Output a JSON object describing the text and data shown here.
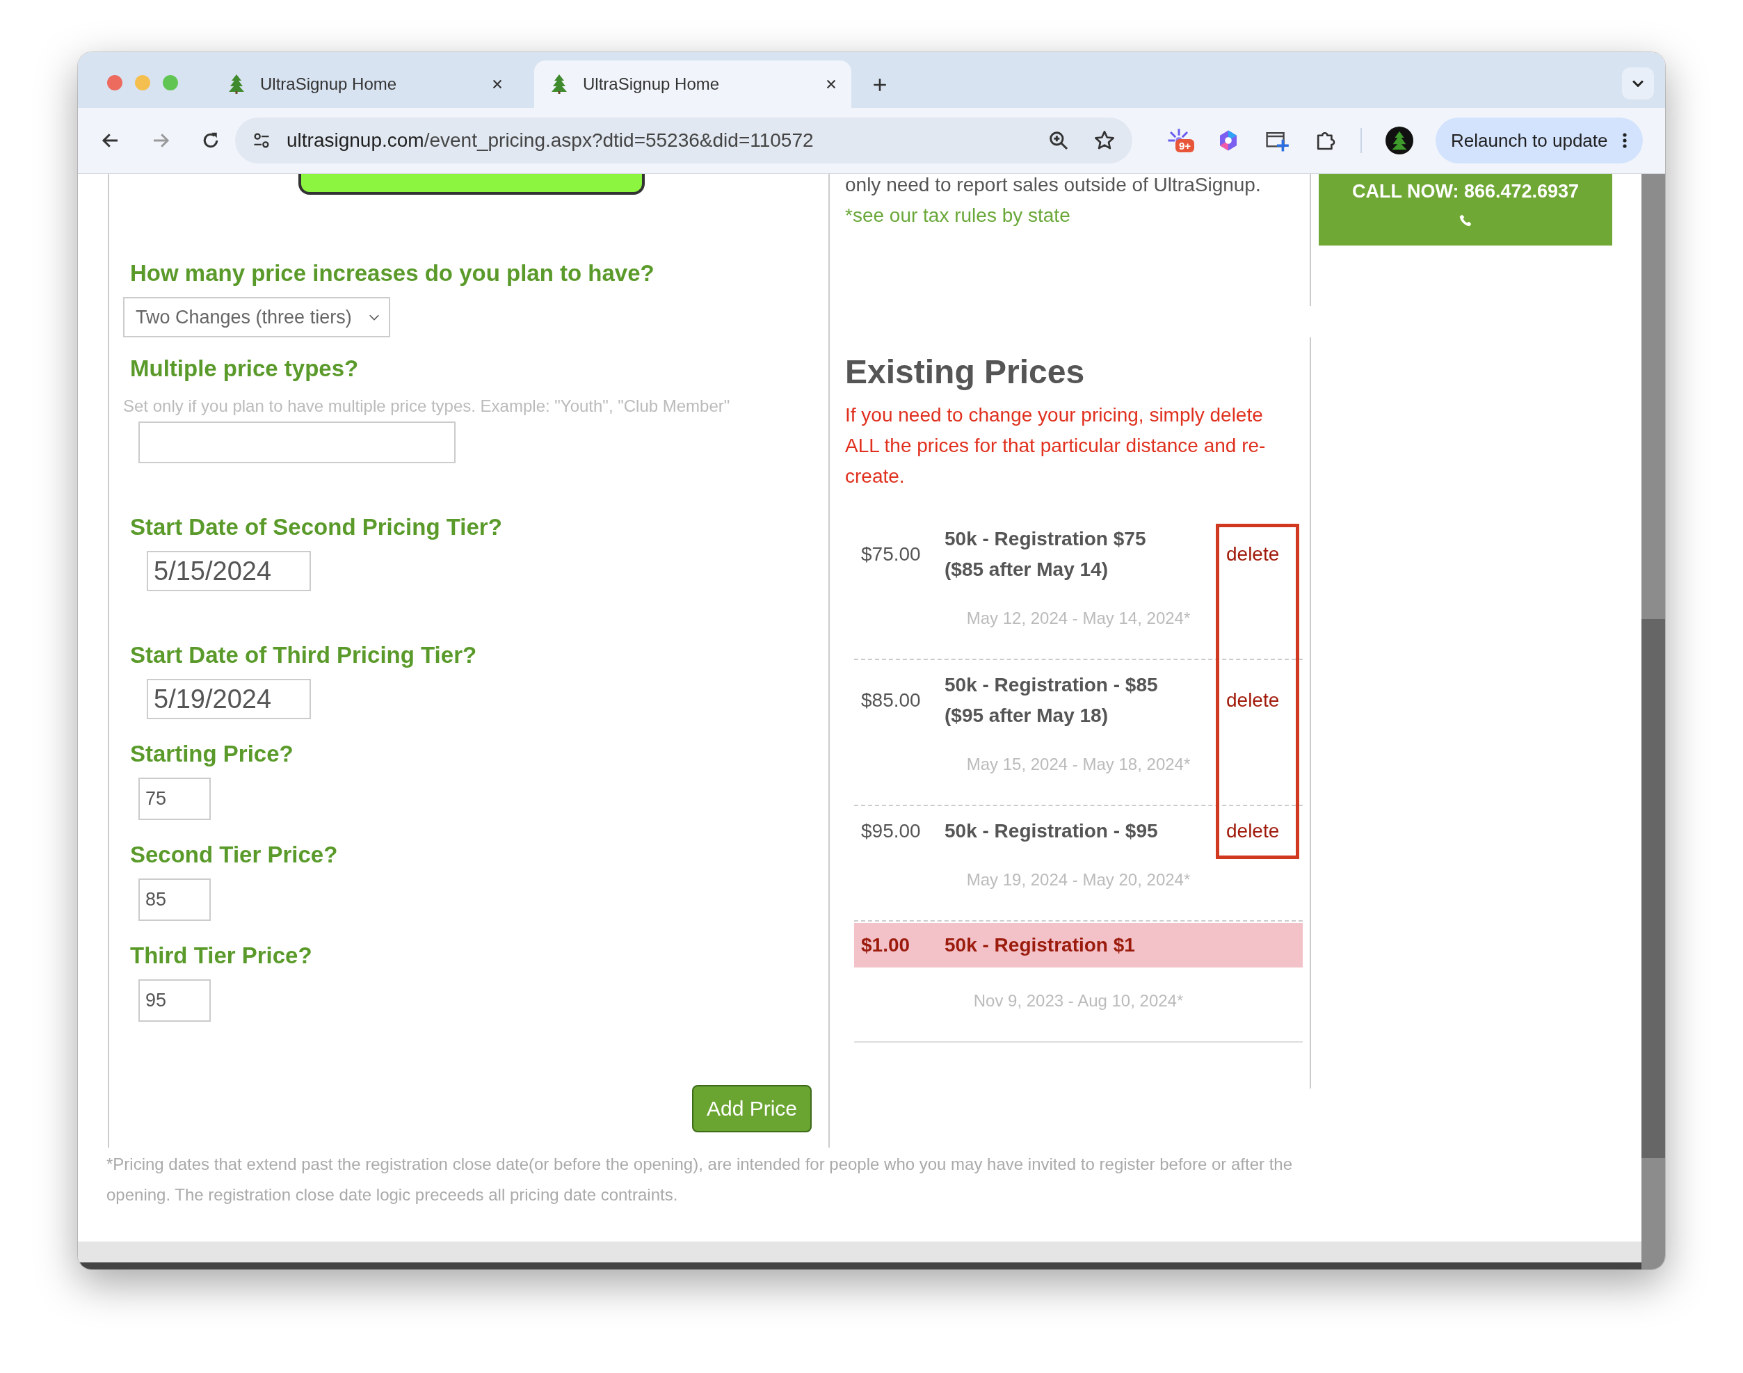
{
  "browser": {
    "tabs": [
      {
        "title": "UltraSignup Home",
        "selected": false
      },
      {
        "title": "UltraSignup Home",
        "selected": true
      }
    ],
    "url": {
      "host": "ultrasignup.com",
      "path": "/event_pricing.aspx?dtid=55236&did=110572"
    },
    "extension_badge": "9+",
    "relaunch_button": "Relaunch to update"
  },
  "form": {
    "fields": [
      {
        "kind": "select",
        "label": "How many price increases do you plan to have?",
        "value": "Two Changes (three tiers)"
      },
      {
        "kind": "text",
        "label": "Multiple price types?",
        "hint": "Set only if you plan to have multiple price types. Example: \"Youth\", \"Club Member\""
      },
      {
        "kind": "date",
        "label": "Start Date of Second Pricing Tier?",
        "value": "5/15/2024"
      },
      {
        "kind": "date",
        "label": "Start Date of Third Pricing Tier?",
        "value": "5/19/2024"
      },
      {
        "kind": "price",
        "label": "Starting Price?",
        "value": "75"
      },
      {
        "kind": "price",
        "label": "Second Tier Price?",
        "value": "85"
      },
      {
        "kind": "price",
        "label": "Third Tier Price?",
        "value": "95"
      }
    ],
    "add_button": "Add Price"
  },
  "tax_note": {
    "text": "only need to report sales outside of UltraSignup.",
    "link": "*see our tax rules by state"
  },
  "existing_prices": {
    "title": "Existing Prices",
    "warning": "If you need to change your pricing, simply delete ALL the prices for that particular distance and re-create.",
    "outline_delete": true,
    "rows": [
      {
        "amount": "$75.00",
        "name": "50k - Registration $75 ($85 after May 14)",
        "dates": "May 12, 2024 - May 14, 2024*",
        "delete": "delete",
        "highlighted": false
      },
      {
        "amount": "$85.00",
        "name": "50k - Registration - $85 ($95 after May 18)",
        "dates": "May 15, 2024 - May 18, 2024*",
        "delete": "delete",
        "highlighted": false
      },
      {
        "amount": "$95.00",
        "name": "50k - Registration - $95",
        "dates": "May 19, 2024 - May 20, 2024*",
        "delete": "delete",
        "highlighted": false
      },
      {
        "amount": "$1.00",
        "name": "50k - Registration $1",
        "dates": "Nov 9, 2023 - Aug 10, 2024*",
        "highlighted": true
      }
    ]
  },
  "call_box": {
    "text": "CALL NOW: 866.472.6937"
  },
  "footnote": "*Pricing dates that extend past the registration close date(or before the opening), are intended for people who you may have invited to register before or after the opening. The registration close date logic preceeds all pricing date contraints."
}
